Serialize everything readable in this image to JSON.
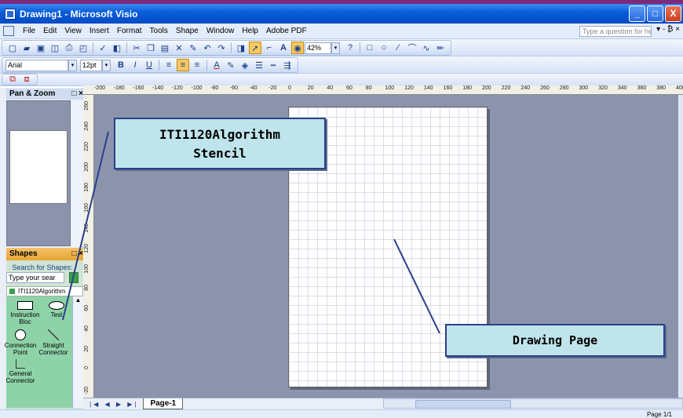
{
  "window": {
    "title": "Drawing1 - Microsoft Visio",
    "controls": {
      "minimize": "_",
      "maximize": "□",
      "close": "X"
    }
  },
  "menubar": {
    "items": [
      "File",
      "Edit",
      "View",
      "Insert",
      "Format",
      "Tools",
      "Shape",
      "Window",
      "Help",
      "Adobe PDF"
    ],
    "help_placeholder": "Type a question for help",
    "tail": "▾ - ₿ ×"
  },
  "toolbar_standard": {
    "zoom_value": "42%"
  },
  "toolbar_format": {
    "font_name": "Arial",
    "font_size": "12pt",
    "bold": "B",
    "italic": "I",
    "underline": "U"
  },
  "pan_zoom": {
    "title": "Pan & Zoom",
    "close_label": "□ ×"
  },
  "shapes_panel": {
    "title": "Shapes",
    "close_label": "□ ×",
    "search_label": "Search for Shapes:",
    "search_placeholder": "Type your sear",
    "stencil_name": "ITI1120Algorithm",
    "items": [
      {
        "label": "Instruction Bloc"
      },
      {
        "label": "Test"
      },
      {
        "label": "Connection Point"
      },
      {
        "label": "Straight Connector"
      },
      {
        "label": "General Connector"
      }
    ]
  },
  "ruler_top_labels": [
    "-200",
    "-180",
    "-160",
    "-140",
    "-120",
    "-100",
    "-80",
    "-60",
    "-40",
    "-20",
    "0",
    "20",
    "40",
    "60",
    "80",
    "100",
    "120",
    "140",
    "160",
    "180",
    "200",
    "220",
    "240",
    "260",
    "280",
    "300",
    "320",
    "340",
    "360",
    "380",
    "400"
  ],
  "ruler_left_labels": [
    "260",
    "240",
    "220",
    "200",
    "180",
    "160",
    "140",
    "120",
    "100",
    "80",
    "60",
    "40",
    "20",
    "0",
    "-20"
  ],
  "page_tabs": {
    "nav": "|◀ ◀ ▶ ▶|",
    "current": "Page-1"
  },
  "statusbar": {
    "page_indicator": "Page 1/1"
  },
  "callouts": {
    "stencil_line1": "ITI1120Algorithm",
    "stencil_line2": "Stencil",
    "drawing": "Drawing Page"
  },
  "colors": {
    "title_bar": "#0554d0",
    "canvas_bg": "#8b94ac",
    "callout_fill": "#bfe4ec",
    "callout_border": "#2a3f8a",
    "stencil_bg": "#8ed3a8",
    "shapes_header": "#e8a431"
  }
}
